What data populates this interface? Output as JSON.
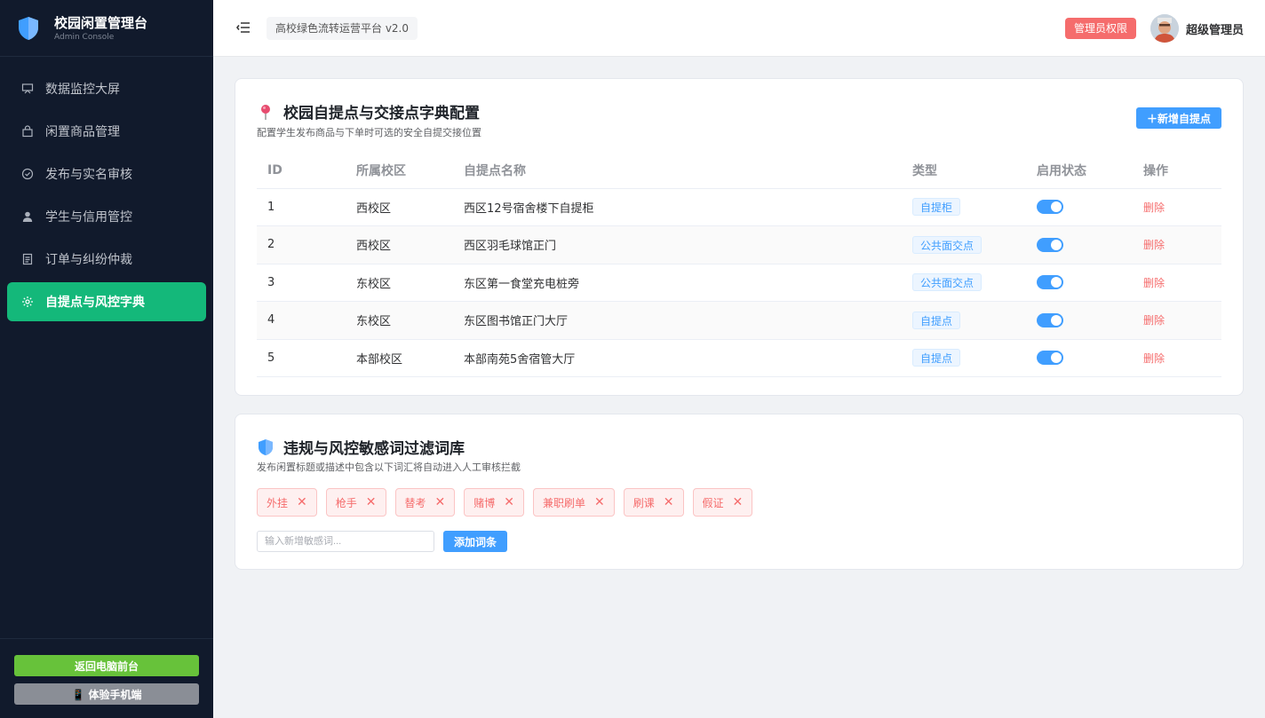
{
  "sidebar": {
    "brand_title": "校园闲置管理台",
    "brand_sub": "Admin Console",
    "items": [
      {
        "label": "数据监控大屏",
        "icon": "monitor-icon"
      },
      {
        "label": "闲置商品管理",
        "icon": "bag-icon"
      },
      {
        "label": "发布与实名审核",
        "icon": "check-circle-icon"
      },
      {
        "label": "学生与信用管控",
        "icon": "user-icon"
      },
      {
        "label": "订单与纠纷仲裁",
        "icon": "document-icon"
      },
      {
        "label": "自提点与风控字典",
        "icon": "gear-icon",
        "active": true
      }
    ],
    "back_pc_label": "返回电脑前台",
    "mobile_label": "📱 体验手机端"
  },
  "header": {
    "platform_name": "高校绿色流转运营平台 v2.0",
    "role_badge": "管理员权限",
    "admin_name": "超级管理员"
  },
  "pickup": {
    "title": "校园自提点与交接点字典配置",
    "subtitle": "配置学生发布商品与下单时可选的安全自提交接位置",
    "add_button": "＋新增自提点",
    "columns": [
      "ID",
      "所属校区",
      "自提点名称",
      "类型",
      "启用状态",
      "操作"
    ],
    "rows": [
      {
        "id": "1",
        "campus": "西校区",
        "name": "西区12号宿舍楼下自提柜",
        "type": "自提柜",
        "enabled": true,
        "action": "删除"
      },
      {
        "id": "2",
        "campus": "西校区",
        "name": "西区羽毛球馆正门",
        "type": "公共面交点",
        "enabled": true,
        "action": "删除"
      },
      {
        "id": "3",
        "campus": "东校区",
        "name": "东区第一食堂充电桩旁",
        "type": "公共面交点",
        "enabled": true,
        "action": "删除"
      },
      {
        "id": "4",
        "campus": "东校区",
        "name": "东区图书馆正门大厅",
        "type": "自提点",
        "enabled": true,
        "action": "删除"
      },
      {
        "id": "5",
        "campus": "本部校区",
        "name": "本部南苑5舍宿管大厅",
        "type": "自提点",
        "enabled": true,
        "action": "删除"
      }
    ]
  },
  "words": {
    "title": "违规与风控敏感词过滤词库",
    "subtitle": "发布闲置标题或描述中包含以下词汇将自动进入人工审核拦截",
    "tags": [
      "外挂",
      "枪手",
      "替考",
      "赌博",
      "兼职刷单",
      "刷课",
      "假证"
    ],
    "remove_symbol": "✕",
    "input_placeholder": "输入新增敏感词...",
    "add_button": "添加词条"
  },
  "colors": {
    "sidebar_bg": "#111a2c",
    "active_green": "#14b87a",
    "primary_blue": "#409eff",
    "danger_red": "#f56c6c"
  }
}
